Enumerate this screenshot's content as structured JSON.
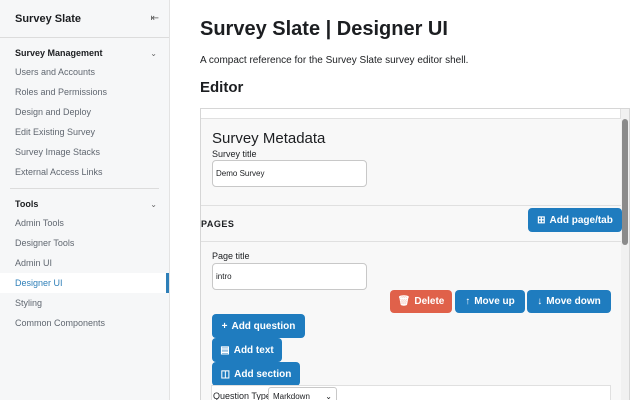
{
  "sidebar": {
    "title": "Survey Slate",
    "collapse_icon": "collapse-sidebar-icon",
    "groups": [
      {
        "title": "Survey Management",
        "items": [
          {
            "label": "Users and Accounts"
          },
          {
            "label": "Roles and Permissions"
          },
          {
            "label": "Design and Deploy"
          },
          {
            "label": "Edit Existing Survey"
          },
          {
            "label": "Survey Image Stacks"
          },
          {
            "label": "External Access Links"
          }
        ]
      },
      {
        "title": "Tools",
        "items": [
          {
            "label": "Admin Tools"
          },
          {
            "label": "Designer Tools"
          },
          {
            "label": "Admin UI"
          },
          {
            "label": "Designer UI",
            "active": true
          },
          {
            "label": "Styling"
          },
          {
            "label": "Common Components"
          }
        ]
      }
    ]
  },
  "main": {
    "title": "Survey Slate | Designer UI",
    "intro": "A compact reference for the Survey Slate survey editor shell.",
    "section_title": "Editor"
  },
  "editor": {
    "metadata_title": "Survey Metadata",
    "survey_title_label": "Survey title",
    "survey_title_value": "Demo Survey",
    "pages_label": "PAGES",
    "add_page_label": "Add page/tab",
    "page_title_label": "Page title",
    "page_title_value": "intro",
    "delete_label": "Delete",
    "move_up_label": "Move up",
    "move_down_label": "Move down",
    "add_question_label": "Add question",
    "add_text_label": "Add text",
    "add_section_label": "Add section",
    "question_type_label": "Question Type",
    "question_type_value": "Markdown"
  },
  "colors": {
    "primary": "#1f7cbf",
    "danger": "#e0614a",
    "active_link": "#2e7fb8"
  }
}
